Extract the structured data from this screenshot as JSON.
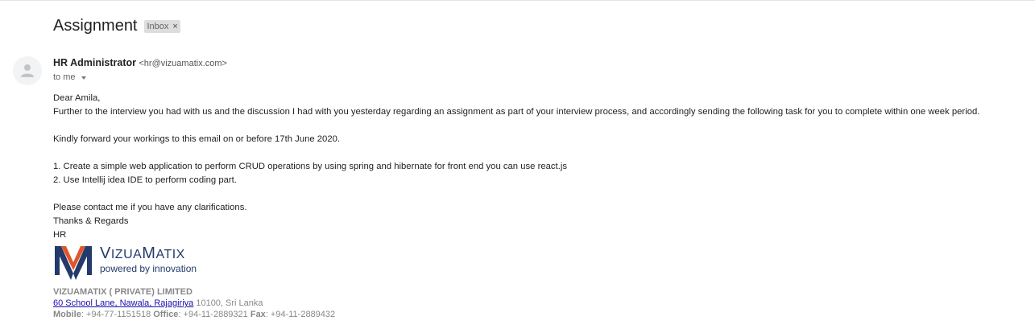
{
  "email": {
    "subject": "Assignment",
    "label": "Inbox",
    "label_close": "×",
    "sender_name": "HR Administrator",
    "sender_email": "<hr@vizuamatix.com>",
    "recipient": "to me"
  },
  "body": {
    "greeting": "Dear Amila,",
    "paragraph1": "Further to the interview you had with us and the discussion I had with you yesterday regarding an assignment as part of your interview process, and accordingly sending the following task for you to complete within one week period.",
    "paragraph2": "Kindly forward your workings to this email on or before 17th June 2020.",
    "task1": "1. Create a simple web application to perform CRUD operations by using  spring and hibernate for front end you can use react.js",
    "task2": "2. Use Intellij idea  IDE to perform coding part.",
    "contact": "Please contact me if you have any clarifications.",
    "closing": "Thanks & Regards",
    "signoff": "HR"
  },
  "logo": {
    "name_big1": "V",
    "name_small1": "IZUA",
    "name_big2": "M",
    "name_small2": "ATIX",
    "tagline": "powered by innovation",
    "colors": {
      "navy": "#233a6b",
      "orange": "#e0562a"
    }
  },
  "signature": {
    "company": "VIZUAMATIX ( PRIVATE) LIMITED",
    "address_link": "60 School Lane, Nawala, Rajagiriya",
    "address_rest": " 10100, Sri Lanka",
    "mobile_label": "Mobile",
    "mobile_value": ": +94-77-1151518 ",
    "office_label": "Office",
    "office_value": ": +94-11-2889321 ",
    "fax_label": "Fax",
    "fax_value": ": +94-11-2889432"
  }
}
